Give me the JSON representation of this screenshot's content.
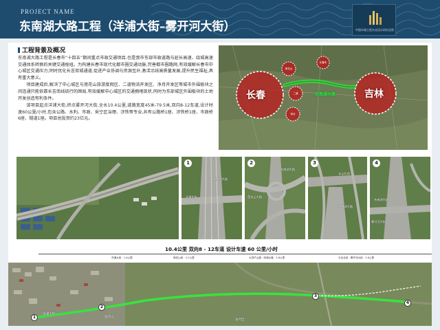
{
  "header": {
    "project_label": "PROJECT NAME",
    "title": "东南湖大路工程（洋浦大街–雾开河大街）",
    "logo_caption": "中国市政工程东北设计研究总院"
  },
  "background": {
    "section_title": "工程背景及概况",
    "paragraphs": [
      "东南湖大路工程是长春市“十四五”期间重点市政交通项目,也是我市东部市政道路与延长高速、绕城高速交通体系转换的关键交通枢纽。为构建长春市现代化都市圈交通动脉,完善都市圈路网,有效缓解长春市中心城区交通压力;同时优化长吉双城通道,促进产业协调与资源互补,激活沿线高质量发展,提升民生福祉,具有重大意义。",
      "项目建成后,解决了中心城区与莲花山旅游度假区、二道物流开发区、净月开发区等城市外围板块之间连通只能依靠长吉南线绕行的困局,有效缓解中心城区的交通拥堵现状,同时为东部城区外围板块的土地开发创造有利条件。",
      "该项目起点洋浦大街,终点雾开河大街,全长10.4公里,道路宽度45米-79.5米,双向8-12车道,设计时速60公里/小时,包含公路、水利、市政、采空区治理、涉铁等专业,共有公路桥1座、涉铁桥1座、市政桥6座、隧道1座。项目总投资约23亿元。"
    ]
  },
  "region_map": {
    "city_left": "长春",
    "city_right": "吉林",
    "road_label": "东南湖大路",
    "zone_labels": [
      "莲花山",
      "二道",
      "净月",
      "长春东"
    ]
  },
  "photos": [
    {
      "num": "",
      "labels": []
    },
    {
      "num": "1",
      "labels": [
        "东南湖大路",
        "洋浦大街"
      ]
    },
    {
      "num": "2",
      "labels": [
        "东南湖大路",
        "莲花山大路"
      ]
    },
    {
      "num": "3",
      "labels": [
        "东南湖大路",
        "长吉北线"
      ]
    },
    {
      "num": "4",
      "labels": [
        "东南湖大路",
        "雾开河大街"
      ]
    }
  ],
  "route": {
    "caption": "10.4公里  双向8 - 12车道  设计车速 60 公里/小时",
    "sections": [
      "洋浦大街 · 1.8公里",
      "莲花山段 · 3.2公里",
      "大顶子山隧 · 西湖大路 · 2.8公里",
      "长吉北线 · 雾开河大街 · 2.6公里"
    ],
    "points": [
      "1",
      "2",
      "3",
      "4"
    ],
    "place_labels": [
      "洋浦大街",
      "莲花山",
      "净月区"
    ]
  },
  "colors": {
    "header_bg": "#1d4c6f",
    "city_circle": "#c0161a",
    "road_green": "#38e33f"
  }
}
